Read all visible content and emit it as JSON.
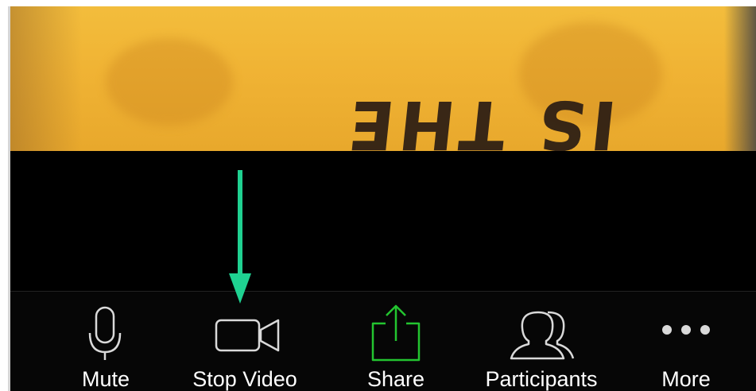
{
  "toolbar": {
    "buttons": [
      {
        "id": "mute",
        "label": "Mute",
        "icon": "microphone-icon"
      },
      {
        "id": "stop-video",
        "label": "Stop Video",
        "icon": "video-camera-icon"
      },
      {
        "id": "share",
        "label": "Share",
        "icon": "share-upload-icon"
      },
      {
        "id": "participants",
        "label": "Participants",
        "icon": "participants-icon"
      },
      {
        "id": "more",
        "label": "More",
        "icon": "more-dots-icon"
      }
    ]
  },
  "colors": {
    "toolbar_background": "#060606",
    "icon_default": "#d9d9d9",
    "share_accent": "#23c430",
    "annotation_arrow": "#1fd191"
  }
}
